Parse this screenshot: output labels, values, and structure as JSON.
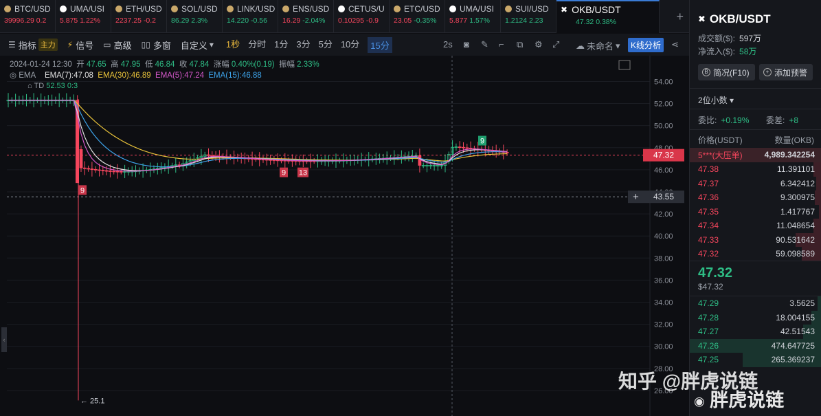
{
  "tabs": [
    {
      "name": "BTC/USD",
      "price": "39996.29",
      "change": "0.2",
      "dir": "down",
      "dot": "#caa86a"
    },
    {
      "name": "UMA/USI",
      "price": "5.875",
      "change": "1.22%",
      "dir": "down",
      "dot": "#ffffff"
    },
    {
      "name": "ETH/USD",
      "price": "2237.25",
      "change": "-0.2",
      "dir": "down",
      "dot": "#caa86a"
    },
    {
      "name": "SOL/USD",
      "price": "86.29",
      "change": "2.3%",
      "dir": "up",
      "dot": "#caa86a"
    },
    {
      "name": "LINK/USD",
      "price": "14.220",
      "change": "-0.56",
      "dir": "up",
      "dot": "#caa86a"
    },
    {
      "name": "ENS/USD",
      "price": "16.29",
      "change": "-2.04%",
      "dir": "plain",
      "dot": "#caa86a"
    },
    {
      "name": "CETUS/U",
      "price": "0.10295",
      "change": "-0.9",
      "dir": "down",
      "dot": "#ffffff"
    },
    {
      "name": "ETC/USD",
      "price": "23.05",
      "change": "-0.35%",
      "dir": "plain",
      "dot": "#caa86a"
    },
    {
      "name": "UMA/USI",
      "price": "5.877",
      "change": "1.57%",
      "dir": "plain",
      "dot": "#ffffff"
    },
    {
      "name": "SUI/USD",
      "price": "1.2124",
      "change": "2.23",
      "dir": "up",
      "dot": "#caa86a"
    }
  ],
  "active_tab": {
    "name": "OKB/USDT",
    "price": "47.32",
    "change": "0.38%"
  },
  "toolbar": {
    "indicators": "指标",
    "indicators_badge": "主力",
    "signal": "信号",
    "advanced": "高级",
    "multi_window": "多窗",
    "custom": "自定义",
    "timeframes": [
      "1秒",
      "分时",
      "1分",
      "3分",
      "5分",
      "10分",
      "15分"
    ],
    "active_timeframe": "15分",
    "refresh": "2s",
    "layout_name": "未命名",
    "kline_button": "K线分析"
  },
  "legend": {
    "date": "2024-01-24 12:30",
    "open_label": "开",
    "open": "47.65",
    "high_label": "高",
    "high": "47.95",
    "low_label": "低",
    "low": "46.84",
    "close_label": "收",
    "close": "47.84",
    "chg_label": "涨幅",
    "chg": "0.40%(0.19)",
    "amp_label": "振幅",
    "amp": "2.33%",
    "ema_name": "EMA",
    "ema7": "EMA(7):47.08",
    "ema30": "EMA(30):46.89",
    "ema5": "EMA(5):47.24",
    "ema15": "EMA(15):46.88",
    "td_label": "TD",
    "td_val": "52.53",
    "td_val2": "0:3"
  },
  "chart_data": {
    "type": "candlestick",
    "ylim": [
      25,
      54.9
    ],
    "yticks": [
      26,
      28,
      30,
      32,
      34,
      36,
      38,
      40,
      42,
      44,
      46,
      48,
      50,
      52,
      54
    ],
    "current_price": 47.32,
    "crosshair_price": 43.55,
    "min_label": "← 25.1",
    "min_value": 25.1,
    "td_markers": [
      {
        "label": "9",
        "price": 44.6,
        "dir": "down"
      },
      {
        "label": "9",
        "price": 46.2,
        "dir": "down"
      },
      {
        "label": "13",
        "price": 46.2,
        "dir": "down"
      },
      {
        "label": "9",
        "price": 48.7,
        "dir": "up"
      }
    ],
    "colors": {
      "up": "#2ebd85",
      "down": "#f6465d",
      "ema7": "#e0e0e0",
      "ema30": "#e8c23a",
      "ema5": "#d257c7",
      "ema15": "#3da2e8"
    }
  },
  "panel": {
    "title": "OKB/USDT",
    "volume_label": "成交额($):",
    "volume": "597万",
    "net_label": "净流入($):",
    "net": "58万",
    "btn_brief": "简况(F10)",
    "btn_alert": "添加预警",
    "decimals": "2位小数",
    "ratio_label": "委比:",
    "ratio": "+0.19%",
    "diff_label": "委差:",
    "diff": "+8",
    "col_price": "价格(USDT)",
    "col_qty": "数量(OKB)",
    "big_order_label": "5***(大压单)",
    "big_order_qty": "4,989.342254",
    "asks": [
      {
        "p": "47.38",
        "q": "11.391101",
        "w": 6
      },
      {
        "p": "47.37",
        "q": "6.342412",
        "w": 4
      },
      {
        "p": "47.36",
        "q": "9.300975",
        "w": 5
      },
      {
        "p": "47.35",
        "q": "1.417767",
        "w": 2
      },
      {
        "p": "47.34",
        "q": "11.048654",
        "w": 6
      },
      {
        "p": "47.33",
        "q": "90.531642",
        "w": 20
      },
      {
        "p": "47.32",
        "q": "59.098589",
        "w": 15
      }
    ],
    "last_price": "47.32",
    "last_price_usd": "$47.32",
    "bids": [
      {
        "p": "47.29",
        "q": "3.5625",
        "w": 3
      },
      {
        "p": "47.28",
        "q": "18.004155",
        "w": 8
      },
      {
        "p": "47.27",
        "q": "42.51543",
        "w": 14
      },
      {
        "p": "47.26",
        "q": "474.647725",
        "w": 100
      },
      {
        "p": "47.25",
        "q": "265.369237",
        "w": 60
      }
    ]
  },
  "watermark": {
    "zhihu": "知乎 @胖虎说链",
    "weibo": "胖虎说链"
  }
}
